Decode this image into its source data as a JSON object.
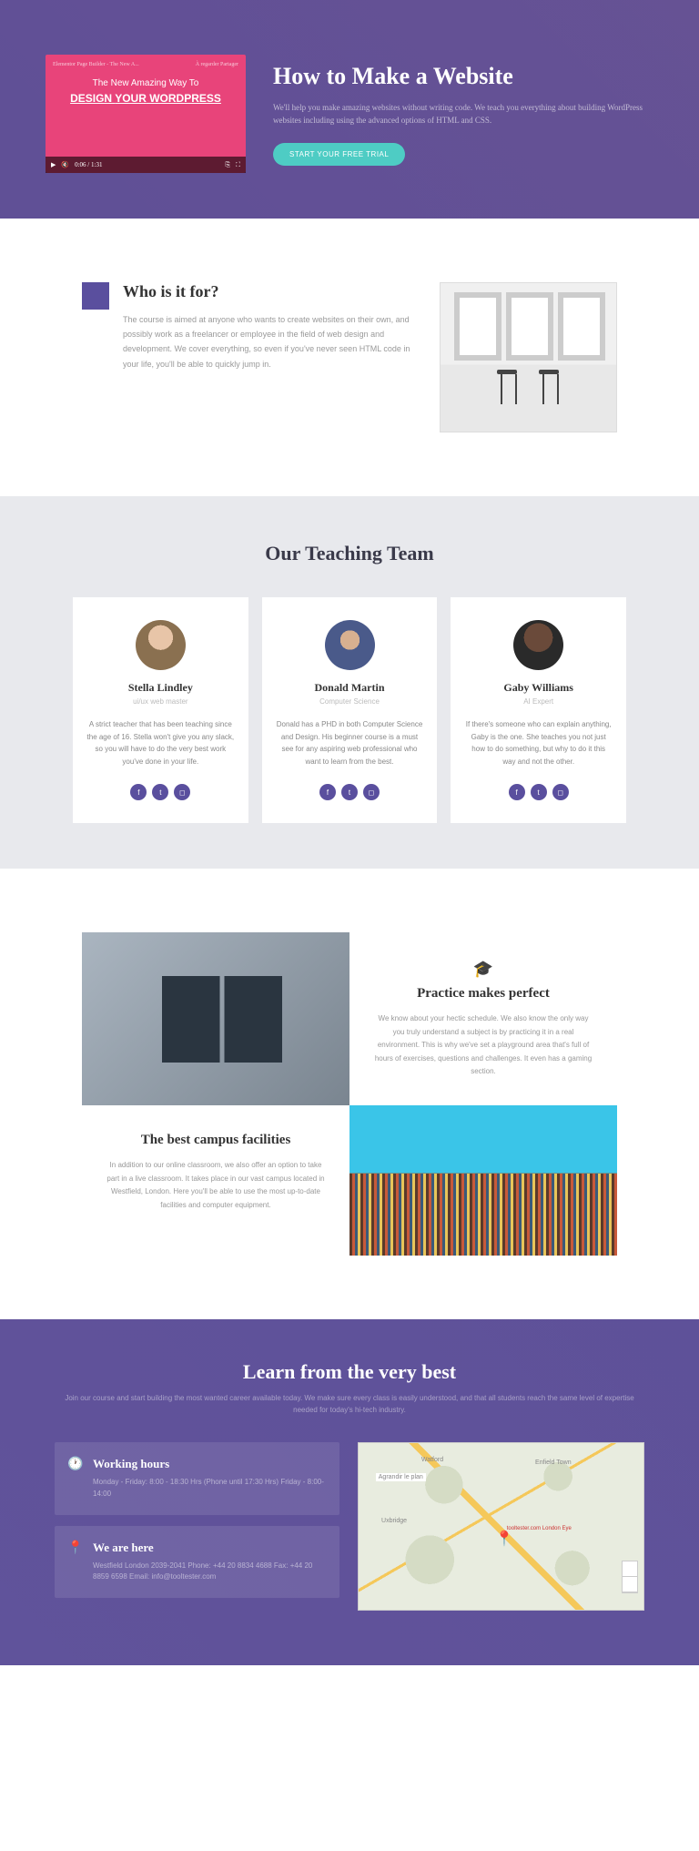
{
  "hero": {
    "video": {
      "top_label": "Elementor Page Builder - The New A...",
      "top_right": "À regarder   Partager",
      "title": "The New Amazing Way To",
      "design_pre": "DESIGN ",
      "design_u": "YOUR",
      "design_post": " WORDPRESS",
      "time": "0:06 / 1:31"
    },
    "title": "How to Make a Website",
    "desc": "We'll help you make amazing websites without writing code. We teach you everything about building WordPress websites including using the advanced options of HTML and CSS.",
    "cta": "START YOUR FREE TRIAL"
  },
  "who": {
    "title": "Who is it for?",
    "body": "The course is aimed at anyone who wants to create websites on their own, and possibly work as a freelancer or employee in the field of web design and development. We cover everything, so even if you've never seen HTML code in your life, you'll be able to quickly jump in."
  },
  "team": {
    "title": "Our Teaching Team",
    "members": [
      {
        "name": "Stella Lindley",
        "role": "ui/ux web master",
        "bio": "A strict teacher that has been teaching since the age of 16. Stella won't give you any slack, so you will have to do the very best work you've done in your life."
      },
      {
        "name": "Donald Martin",
        "role": "Computer Science",
        "bio": "Donald has a PHD in both Computer Science and Design. His beginner course is a must see for any aspiring web professional who want to learn from the best."
      },
      {
        "name": "Gaby Williams",
        "role": "AI Expert",
        "bio": "If there's someone who can explain anything, Gaby is the one. She teaches you not just how to do something, but why to do it this way and not the other."
      }
    ]
  },
  "features": {
    "practice": {
      "title": "Practice makes perfect",
      "body": "We know about your hectic schedule. We also know the only way you truly understand a subject is by practicing it in a real environment. This is why we've set a playground area that's full of hours of exercises, questions and challenges. It even has a gaming section."
    },
    "campus": {
      "title": "The best campus facilities",
      "body": "In addition to our online classroom, we also offer an option to take part in a live classroom. It takes place in our vast campus located in Westfield, London. Here you'll be able to use the most up-to-date facilities and computer equipment."
    }
  },
  "learn": {
    "title": "Learn from the very best",
    "sub": "Join our course and start building the most wanted career available today. We make sure every class is easily understood, and that all students reach the same level of expertise needed for today's hi-tech industry.",
    "hours": {
      "title": "Working hours",
      "body": "Monday - Friday: 8:00 - 18:30 Hrs\n(Phone until 17:30 Hrs)\nFriday - 8:00-14:00"
    },
    "here": {
      "title": "We are here",
      "body": "Westfield London 2039-2041\nPhone: +44 20 8834 4688\nFax: +44 20 8859 6598\nEmail: info@tooltester.com"
    },
    "map": {
      "l1": "Watford",
      "l2": "Enfield Town",
      "l3": "Uxbridge",
      "l4": "Agrandir le plan",
      "l5": "tooltester.com London Eye"
    }
  }
}
